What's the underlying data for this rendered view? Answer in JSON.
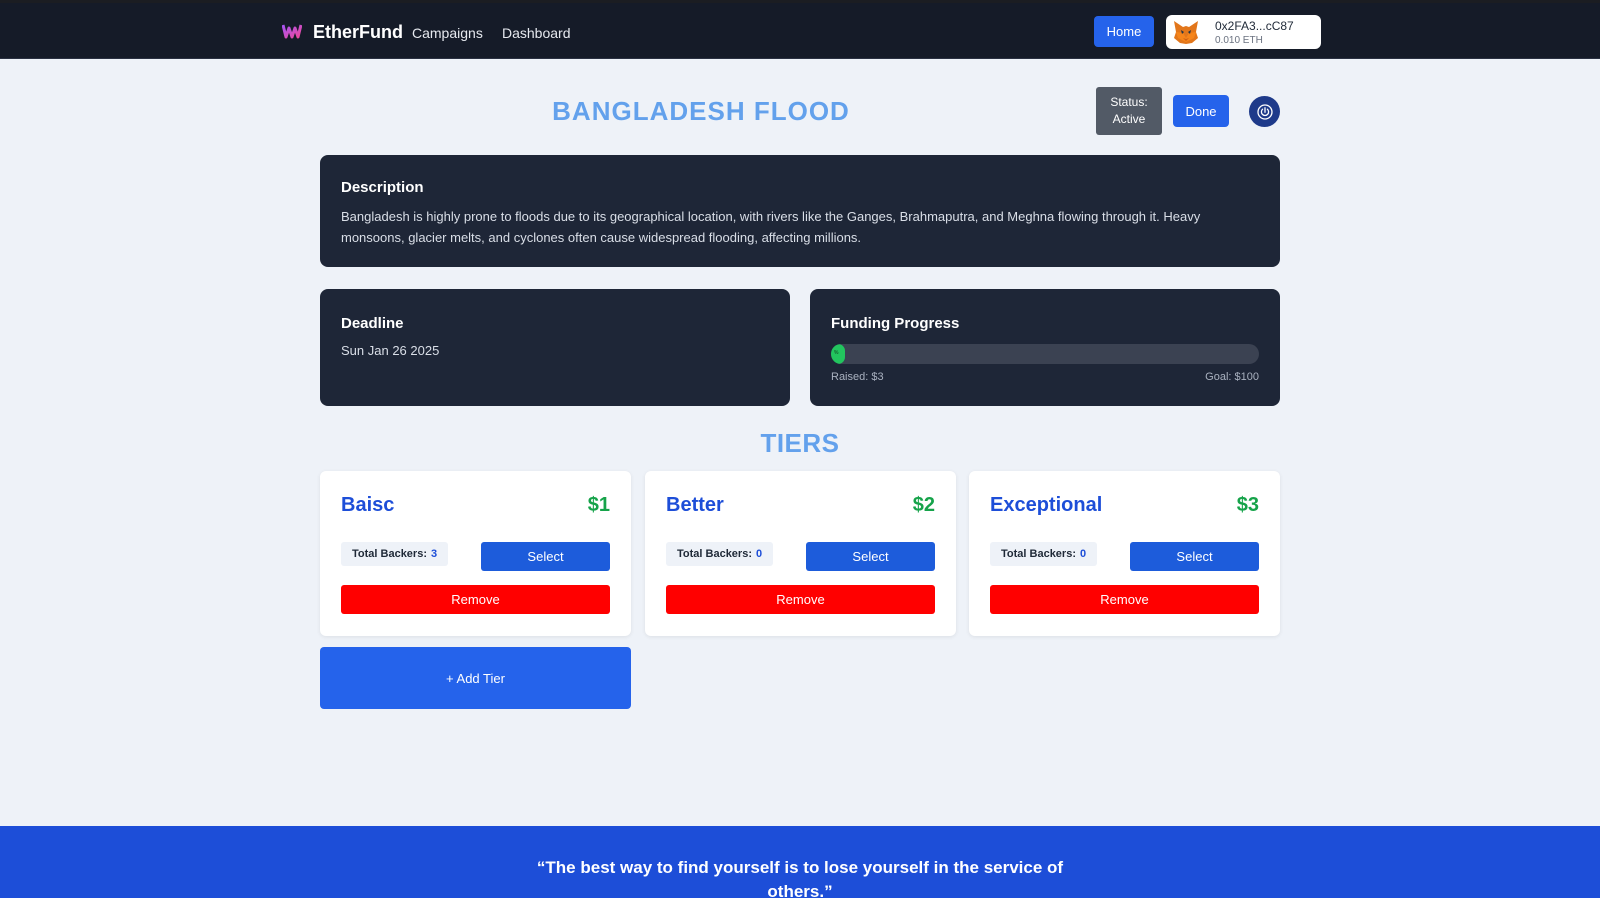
{
  "navbar": {
    "brand": "EtherFund",
    "links": [
      "Campaigns",
      "Dashboard"
    ],
    "home_label": "Home",
    "wallet": {
      "address": "0x2FA3...cC87",
      "balance": "0.010 ETH"
    }
  },
  "campaign": {
    "title": "BANGLADESH FLOOD",
    "status_label": "Status:",
    "status_value": "Active",
    "done_label": "Done",
    "description_heading": "Description",
    "description": "Bangladesh is highly prone to floods due to its geographical location, with rivers like the Ganges, Brahmaputra, and Meghna flowing through it. Heavy monsoons, glacier melts, and cyclones often cause widespread flooding, affecting millions.",
    "deadline_heading": "Deadline",
    "deadline": "Sun Jan 26 2025",
    "funding_heading": "Funding Progress",
    "progress_percent_label": "%",
    "progress_fraction": 0.03,
    "raised": "Raised: $3",
    "goal": "Goal: $100"
  },
  "tiers": {
    "title": "TIERS",
    "items": [
      {
        "name": "Baisc",
        "price": "$1",
        "backers_label": "Total Backers:",
        "backers": "3",
        "select_label": "Select",
        "remove_label": "Remove"
      },
      {
        "name": "Better",
        "price": "$2",
        "backers_label": "Total Backers:",
        "backers": "0",
        "select_label": "Select",
        "remove_label": "Remove"
      },
      {
        "name": "Exceptional",
        "price": "$3",
        "backers_label": "Total Backers:",
        "backers": "0",
        "select_label": "Select",
        "remove_label": "Remove"
      }
    ],
    "add_label": "+ Add Tier"
  },
  "footer": {
    "quote": "“The best way to find yourself is to lose yourself in the service of others.”"
  },
  "colors": {
    "accent": "#2563eb",
    "title": "#63a1ec",
    "danger": "#ff0000",
    "success": "#16a34a",
    "card_dark": "#1e2637"
  }
}
